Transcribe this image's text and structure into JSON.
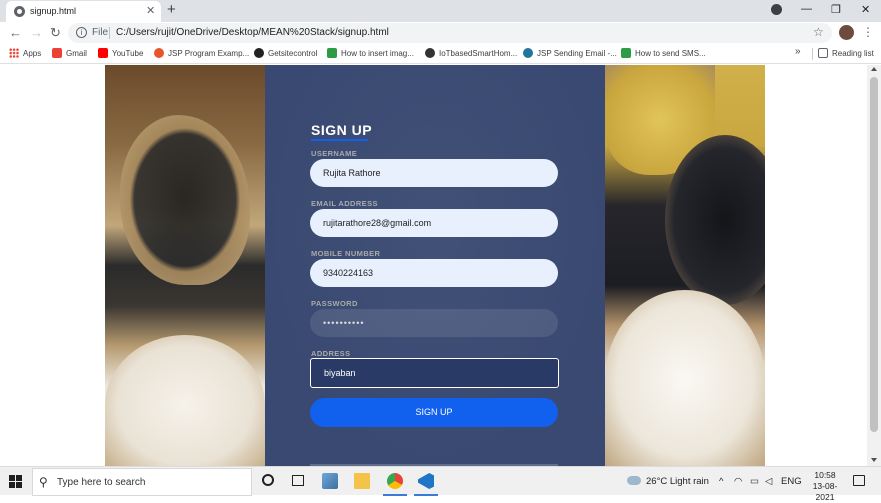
{
  "browser": {
    "tab": {
      "title": "signup.html",
      "close": "✕"
    },
    "new_tab": "+",
    "window_controls": {
      "minimize": "—",
      "restore": "❐",
      "close": "✕"
    },
    "toolbar": {
      "back": "←",
      "forward": "→",
      "reload": "↻",
      "scheme_label": "File",
      "url": "C:/Users/rujit/OneDrive/Desktop/MEAN%20Stack/signup.html",
      "star": "☆",
      "menu": "⋮"
    },
    "bookmarks": [
      {
        "label": "Apps",
        "icon": "apps-grid-icon"
      },
      {
        "label": "Gmail",
        "icon": "gmail-icon",
        "color": "#ea4335"
      },
      {
        "label": "YouTube",
        "icon": "youtube-icon",
        "color": "#ff0000"
      },
      {
        "label": "JSP Program Examp...",
        "icon": "site-icon",
        "color": "#e8552a"
      },
      {
        "label": "Getsitecontrol",
        "icon": "getsitecontrol-icon",
        "color": "#222222"
      },
      {
        "label": "How to insert imag...",
        "icon": "stackoverflow-icon",
        "color": "#2e9b47"
      },
      {
        "label": "IoTbasedSmartHom...",
        "icon": "site-icon",
        "color": "#333333"
      },
      {
        "label": "JSP Sending Email -...",
        "icon": "wordpress-icon",
        "color": "#21759b"
      },
      {
        "label": "How to send SMS...",
        "icon": "stackoverflow-icon",
        "color": "#2e9b47"
      }
    ],
    "bookmarks_overflow": "»",
    "reading_list": "Reading list"
  },
  "form": {
    "title": "SIGN UP",
    "fields": {
      "username": {
        "label": "USERNAME",
        "value": "Rujita Rathore"
      },
      "email": {
        "label": "EMAIL ADDRESS",
        "value": "rujitarathore28@gmail.com"
      },
      "mobile": {
        "label": "MOBILE NUMBER",
        "value": "9340224163"
      },
      "password": {
        "label": "PASSWORD",
        "value": "••••••••••"
      },
      "address": {
        "label": "ADDRESS",
        "value": "biyaban"
      }
    },
    "submit_label": "SIGN UP",
    "accent_color": "#1161ee",
    "panel_color": "#283965"
  },
  "taskbar": {
    "search_placeholder": "Type here to search",
    "weather": "26°C  Light rain",
    "language": "ENG",
    "time": "10:58",
    "date": "13-08-2021"
  }
}
